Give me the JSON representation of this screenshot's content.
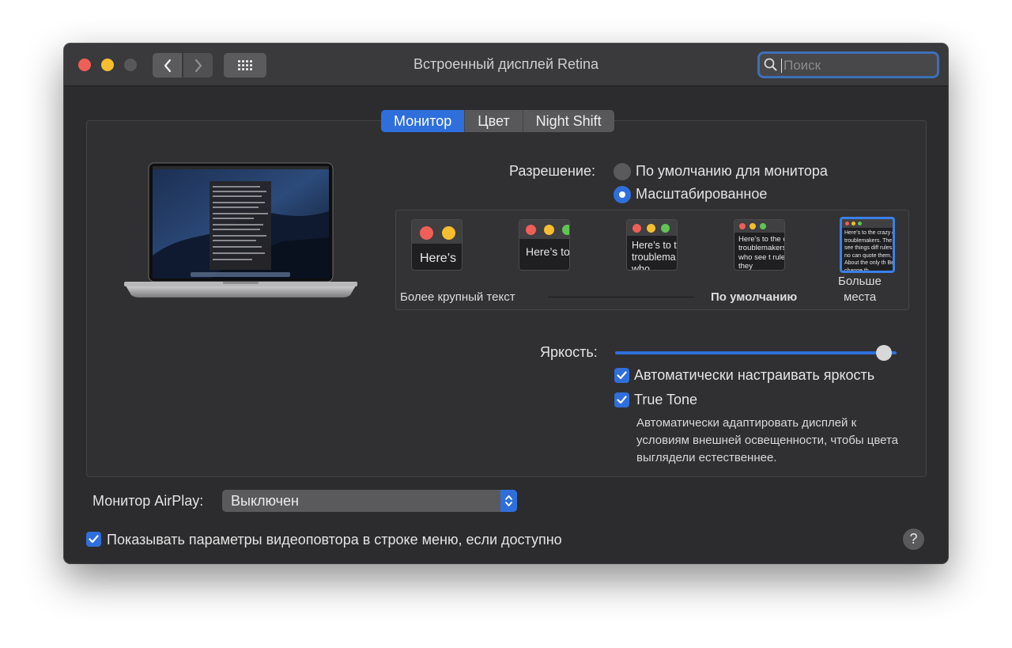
{
  "window": {
    "title": "Встроенный дисплей Retina"
  },
  "search": {
    "placeholder": "Поиск"
  },
  "tabs": [
    {
      "label": "Монитор",
      "active": true
    },
    {
      "label": "Цвет",
      "active": false
    },
    {
      "label": "Night Shift",
      "active": false
    }
  ],
  "resolution": {
    "label": "Разрешение:",
    "options": [
      {
        "label": "По умолчанию для монитора",
        "selected": false
      },
      {
        "label": "Масштабированное",
        "selected": true
      }
    ]
  },
  "scaling": {
    "thumbs": [
      {
        "text": "Here’s"
      },
      {
        "text": "Here’s to troublem"
      },
      {
        "text": "Here’s to t troublema ones who"
      },
      {
        "text": "Here’s to the cr troublemakers. ones who see t rules. And they"
      },
      {
        "text": "Here’s to the crazy ones troublemakers. The rou ones who see things diff rules. And they have no can quote them, disagre them. About the only th Because they change th"
      }
    ],
    "selected_index": 4,
    "left_label": "Более крупный текст",
    "default_label": "По умолчанию",
    "right_label_line1": "Больше",
    "right_label_line2": "места"
  },
  "brightness": {
    "label": "Яркость:",
    "level_fraction": 0.96,
    "auto_label": "Автоматически настраивать яркость",
    "auto_checked": true,
    "truetone_label": "True Tone",
    "truetone_checked": true,
    "truetone_desc": "Автоматически адаптировать дисплей к условиям внешней освещенности, чтобы цвета выглядели естественнее."
  },
  "airplay": {
    "label": "Монитор AirPlay:",
    "value": "Выключен"
  },
  "mirroring": {
    "label": "Показывать параметры видеоповтора в строке меню, если доступно",
    "checked": true
  },
  "help": {
    "label": "?"
  },
  "colors": {
    "accent": "#2f6fdc",
    "window_bg": "#2c2c2e",
    "titlebar_bg": "#3a3a3c"
  }
}
